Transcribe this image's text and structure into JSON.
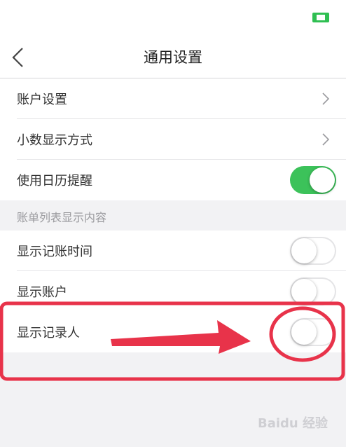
{
  "nav": {
    "title": "通用设置"
  },
  "rows": [
    {
      "label": "账户设置"
    },
    {
      "label": "小数显示方式"
    },
    {
      "label": "使用日历提醒"
    }
  ],
  "section": {
    "label": "账单列表显示内容"
  },
  "rows2": [
    {
      "label": "显示记账时间"
    },
    {
      "label": "显示账户"
    },
    {
      "label": "显示记录人"
    }
  ],
  "watermark": "Baidu 经验",
  "colors": {
    "accent": "#3cc25a",
    "annotation": "#e8334a"
  }
}
